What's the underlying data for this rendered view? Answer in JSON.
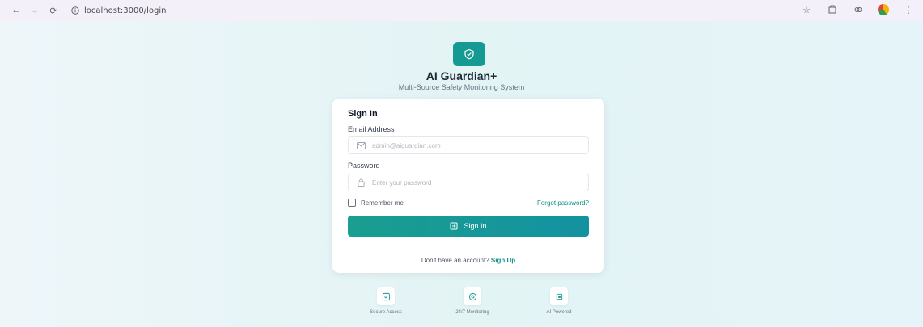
{
  "browser": {
    "url": "localhost:3000/login"
  },
  "brand": {
    "title": "AI Guardian+",
    "subtitle": "Multi-Source Safety Monitoring System",
    "accent": "#159a93"
  },
  "signin": {
    "title": "Sign In",
    "email_label": "Email Address",
    "email_placeholder": "admin@aiguardian.com",
    "password_label": "Password",
    "password_placeholder": "Enter your password",
    "remember_label": "Remember me",
    "forgot_label": "Forgot password?",
    "button_label": "Sign In",
    "signup_prompt": "Don't have an account?",
    "signup_link": "Sign Up"
  },
  "features": [
    {
      "label": "Secure Access",
      "icon": "shield-check-icon"
    },
    {
      "label": "24/7 Monitoring",
      "icon": "eye-icon"
    },
    {
      "label": "AI Powered",
      "icon": "cpu-icon"
    }
  ]
}
